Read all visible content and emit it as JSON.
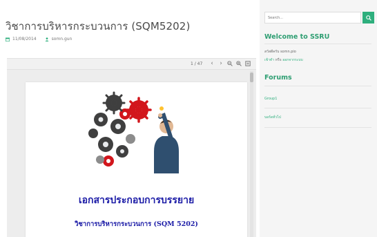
{
  "post": {
    "title": "วิชาการบริหารกระบวนการ (SQM5202)",
    "date": "11/08/2014",
    "author": "somn.gun"
  },
  "viewer": {
    "page_indicator": "1 / 47",
    "icons": [
      "prev-page-icon",
      "next-page-icon",
      "zoom-out-icon",
      "zoom-in-icon",
      "download-icon"
    ],
    "document": {
      "heading": "เอกสารประกอบการบรรยาย",
      "subheading": "วิชาการบริหารกระบวนการ (SQM 5202)"
    }
  },
  "sidebar": {
    "search": {
      "placeholder": "Search..."
    },
    "welcome": {
      "title": "Welcome to SSRU",
      "greeting": "สวัสดีครับ somn.pio",
      "login_label": "เข้าทำ",
      "or_label": "หรือ",
      "register_label": "ออกจากระบบ"
    },
    "forums": {
      "title": "Forums",
      "items": [
        "Group1",
        "บอร์ดทั่วไป"
      ]
    }
  },
  "colors": {
    "accent": "#2eaf7d",
    "accent_text": "#2e9e72",
    "doc_text": "#1a1aa6"
  }
}
